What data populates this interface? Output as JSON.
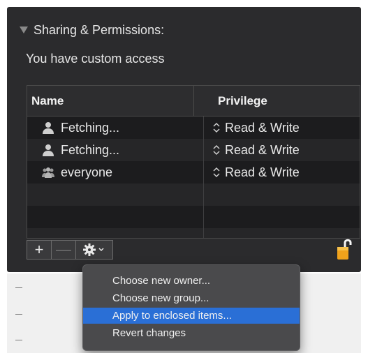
{
  "section": {
    "title": "Sharing & Permissions:",
    "access_text": "You have custom access"
  },
  "table": {
    "headers": {
      "name": "Name",
      "privilege": "Privilege"
    },
    "rows": [
      {
        "name": "Fetching...",
        "privilege": "Read & Write",
        "icon": "user-icon"
      },
      {
        "name": "Fetching...",
        "privilege": "Read & Write",
        "icon": "user-icon"
      },
      {
        "name": "everyone",
        "privilege": "Read & Write",
        "icon": "group-icon"
      }
    ]
  },
  "toolbar": {
    "add_label": "+",
    "remove_label": "—",
    "action_icon": "gear-icon"
  },
  "menu": {
    "items": [
      {
        "label": "Choose new owner...",
        "selected": false
      },
      {
        "label": "Choose new group...",
        "selected": false
      },
      {
        "label": "Apply to enclosed items...",
        "selected": true
      },
      {
        "label": "Revert changes",
        "selected": false
      }
    ]
  },
  "colors": {
    "panel": "#2b2b2d",
    "selection": "#2a6fd6",
    "lock": "#f0a21b"
  }
}
